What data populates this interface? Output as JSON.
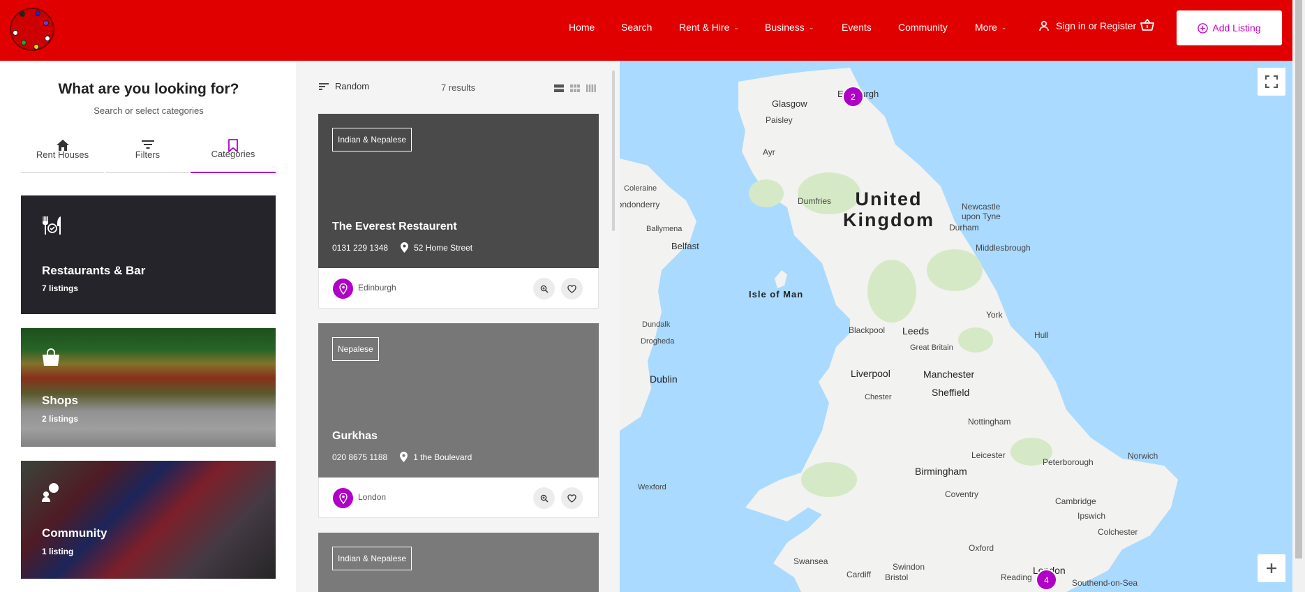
{
  "header": {
    "logo_alt": "logo",
    "nav": [
      {
        "label": "Home",
        "dropdown": false
      },
      {
        "label": "Search",
        "dropdown": false
      },
      {
        "label": "Rent & Hire",
        "dropdown": true
      },
      {
        "label": "Business",
        "dropdown": true
      },
      {
        "label": "Events",
        "dropdown": false
      },
      {
        "label": "Community",
        "dropdown": false
      },
      {
        "label": "More",
        "dropdown": true
      }
    ],
    "signin_label": "Sign in or Register",
    "add_listing_label": "Add Listing",
    "brand_color": "#e00000",
    "accent_color": "#b000c8"
  },
  "sidebar": {
    "title": "What are you looking for?",
    "subtitle": "Search or select categories",
    "tabs": [
      {
        "label": "Rent Houses",
        "icon": "home-icon",
        "active": false
      },
      {
        "label": "Filters",
        "icon": "filter-icon",
        "active": false
      },
      {
        "label": "Categories",
        "icon": "bookmark-icon",
        "active": true
      }
    ],
    "categories": [
      {
        "name": "Restaurants & Bar",
        "count": "7 listings",
        "icon": "restaurant-icon"
      },
      {
        "name": "Shops",
        "count": "2 listings",
        "icon": "shopping-bag-icon"
      },
      {
        "name": "Community",
        "count": "1 listing",
        "icon": "community-icon"
      }
    ]
  },
  "listing": {
    "sort_label": "Random",
    "results_label": "7 results",
    "cards": [
      {
        "badge": "Indian & Nepalese",
        "title": "The Everest Restaurent",
        "phone": "0131 229 1348",
        "address": "52 Home Street",
        "location": "Edinburgh"
      },
      {
        "badge": "Nepalese",
        "title": "Gurkhas",
        "phone": "020 8675 1188",
        "address": "1 the Boulevard",
        "location": "London"
      },
      {
        "badge": "Indian & Nepalese",
        "title": "",
        "phone": "",
        "address": "",
        "location": ""
      }
    ]
  },
  "map": {
    "country": "United Kingdom",
    "island": "Isle of Man",
    "cities": [
      "Glasgow",
      "Edinburgh",
      "Paisley",
      "Ayr",
      "Dumfries",
      "Newcastle upon Tyne",
      "Durham",
      "Middlesbrough",
      "Coleraine",
      "Londonderry",
      "Ballymena",
      "Belfast",
      "Dundalk",
      "Drogheda",
      "Dublin",
      "York",
      "Leeds",
      "Blackpool",
      "Hull",
      "Great Britain",
      "Liverpool",
      "Manchester",
      "Sheffield",
      "Chester",
      "Nottingham",
      "Leicester",
      "Peterborough",
      "Norwich",
      "Birmingham",
      "Coventry",
      "Cambridge",
      "Ipswich",
      "Colchester",
      "Wexford",
      "Oxford",
      "Swansea",
      "Swindon",
      "Cardiff",
      "Bristol",
      "Reading",
      "London",
      "Southend-on-Sea"
    ],
    "clusters": [
      {
        "count": "2",
        "place": "Edinburgh"
      },
      {
        "count": "4",
        "place": "London"
      }
    ]
  }
}
